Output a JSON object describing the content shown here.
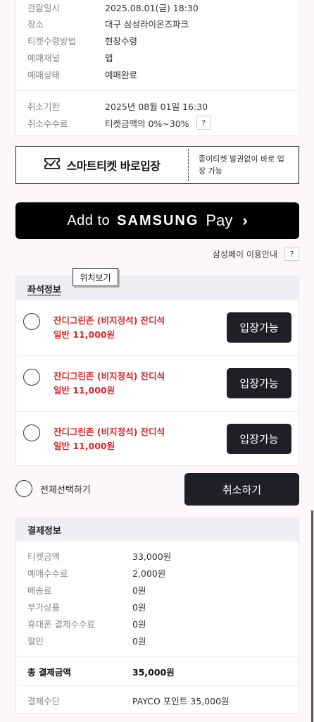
{
  "booking_info": {
    "rows": [
      {
        "label": "관람일시",
        "value": "2025.08.01(금) 18:30"
      },
      {
        "label": "장소",
        "value": "대구 삼성라이온즈파크"
      },
      {
        "label": "티켓수령방법",
        "value": "현장수령"
      },
      {
        "label": "예매채널",
        "value": "앱"
      },
      {
        "label": "예매상태",
        "value": "예매완료"
      }
    ],
    "cancel_deadline_label": "취소기한",
    "cancel_deadline_value": "2025년 08월 01일 16:30",
    "cancel_fee_label": "취소수수료",
    "cancel_fee_value": "티켓금액의 0%~30%",
    "help_label": "?"
  },
  "smart_ticket": {
    "title": "스마트티켓 바로입장",
    "description": "종이티켓 발권없이 바로 입장 가능",
    "icon": "ticket-check-icon"
  },
  "samsung_pay": {
    "add_to": "Add to",
    "brand": "SAMSUNG",
    "pay": "Pay",
    "chevron": "›",
    "guide_label": "삼성페이 이용안내",
    "help_label": "?"
  },
  "seats": {
    "section_title": "좌석정보",
    "tooltip": "위치보기",
    "items": [
      {
        "name": "잔디그린존 (비지정석) 잔디석",
        "price": "일반 11,000원",
        "button": "입장가능"
      },
      {
        "name": "잔디그린존 (비지정석) 잔디석",
        "price": "일반 11,000원",
        "button": "입장가능"
      },
      {
        "name": "잔디그린존 (비지정석) 잔디석",
        "price": "일반 11,000원",
        "button": "입장가능"
      }
    ],
    "select_all_label": "전체선택하기",
    "cancel_button": "취소하기"
  },
  "payment": {
    "section_title": "결제정보",
    "rows": [
      {
        "label": "티켓금액",
        "value": "33,000원"
      },
      {
        "label": "예매수수료",
        "value": "2,000원"
      },
      {
        "label": "배송료",
        "value": "0원"
      },
      {
        "label": "부가상품",
        "value": "0원"
      },
      {
        "label": "휴대폰 결제수수료",
        "value": "0원"
      },
      {
        "label": "할인",
        "value": "0원"
      }
    ],
    "total_label": "총 결제금액",
    "total_value": "35,000원",
    "method_label": "결제수단",
    "method_value": "PAYCO 포인트 35,000원"
  },
  "colors": {
    "accent_red": "#d42b2b",
    "dark_button": "#1f1f28",
    "samsung_black": "#000000"
  }
}
